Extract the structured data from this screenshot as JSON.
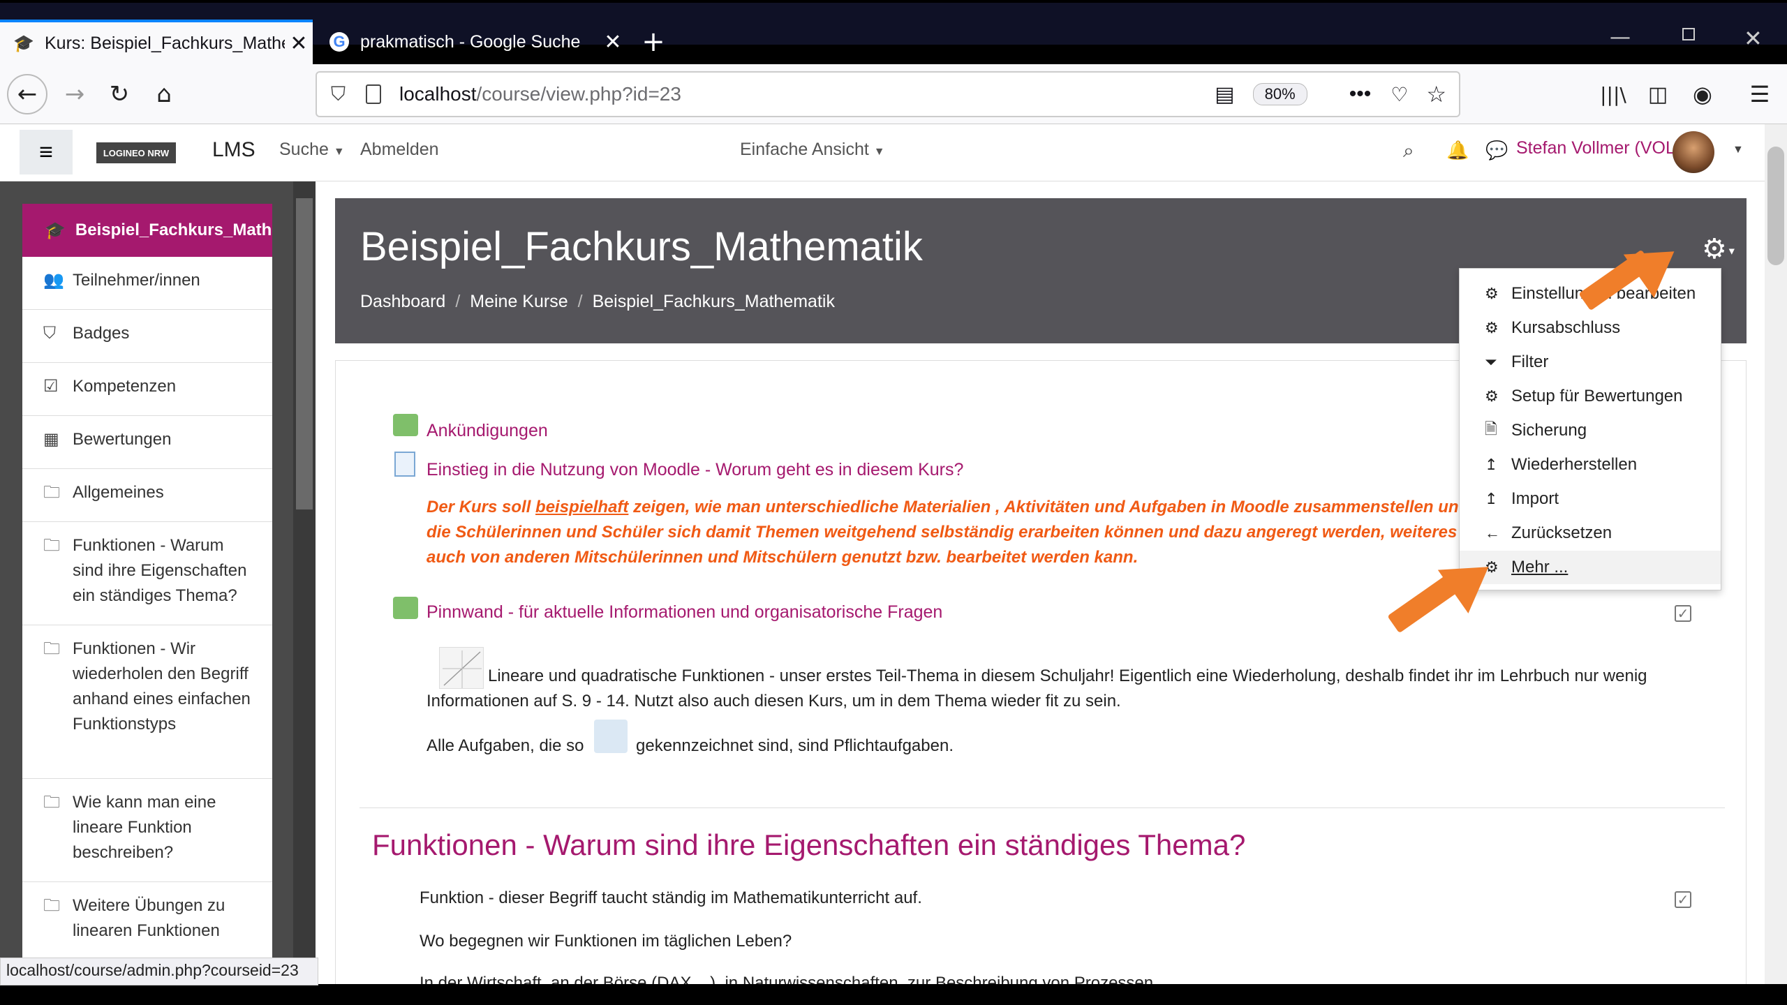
{
  "browser": {
    "tabs": [
      {
        "title": "Kurs: Beispiel_Fachkurs_Mathem"
      },
      {
        "title": "prakmatisch - Google Suche"
      }
    ],
    "url_host": "localhost",
    "url_path": "/course/view.php?id=23",
    "zoom": "80%",
    "status_url": "localhost/course/admin.php?courseid=23"
  },
  "header": {
    "logo_text": "LOGINEO NRW",
    "app": "LMS",
    "search": "Suche",
    "logout": "Abmelden",
    "view": "Einfache Ansicht",
    "user": "Stefan Vollmer (VOL)"
  },
  "sidebar": {
    "course": "Beispiel_Fachkurs_Mathematik",
    "items": [
      {
        "icon": "users-icon",
        "label": "Teilnehmer/innen"
      },
      {
        "icon": "shield-icon",
        "label": "Badges"
      },
      {
        "icon": "check-square-icon",
        "label": "Kompetenzen"
      },
      {
        "icon": "table-icon",
        "label": "Bewertungen"
      },
      {
        "icon": "folder-icon",
        "label": "Allgemeines"
      },
      {
        "icon": "folder-icon",
        "label": "Funktionen - Warum sind ihre Eigenschaften ein ständiges Thema?"
      },
      {
        "icon": "folder-icon",
        "label": "Funktionen - Wir wiederholen den Begriff anhand eines einfachen Funktionstyps"
      },
      {
        "icon": "folder-icon",
        "label": "Wie kann man eine lineare Funktion beschreiben?"
      },
      {
        "icon": "folder-icon",
        "label": "Weitere Übungen zu linearen Funktionen"
      }
    ]
  },
  "course": {
    "title": "Beispiel_Fachkurs_Mathematik",
    "breadcrumb": [
      "Dashboard",
      "Meine Kurse",
      "Beispiel_Fachkurs_Mathematik"
    ],
    "announcements": "Ankündigungen",
    "intro_link": "Einstieg in die Nutzung von Moodle - Worum geht es in diesem Kurs?",
    "orange_1a": "Der Kurs soll ",
    "orange_1b": "beispielhaft",
    "orange_1c": " zeigen, wie man unterschiedliche Materialien , Aktivitäten und Aufgaben in Moodle zusammenstellen und",
    "orange_2": "die Schülerinnen und Schüler sich damit Themen weitgehend selbständig erarbeiten können und dazu angeregt werden, weiteres M",
    "orange_3": "auch von anderen Mitschülerinnen und Mitschülern genutzt bzw. bearbeitet werden kann.",
    "pinnwand": "Pinnwand - für aktuelle Informationen und organisatorische Fragen",
    "lin_1": "Lineare und quadratische Funktionen - unser erstes Teil-Thema in diesem Schuljahr! Eigentlich eine Wiederholung, deshalb findet ihr im Lehrbuch nur wenig",
    "lin_2": "Informationen auf S. 9 - 14. Nutzt also auch diesen Kurs, um in dem Thema wieder fit zu sein.",
    "tasks_a": "Alle Aufgaben, die so",
    "tasks_b": "gekennzeichnet sind, sind Pflichtaufgaben.",
    "section_title": "Funktionen - Warum sind ihre Eigenschaften ein ständiges Thema?",
    "sec_1": "Funktion - dieser Begriff taucht ständig im Mathematikunterricht auf.",
    "sec_2": "Wo begegnen wir Funktionen im täglichen Leben?",
    "sec_3": "In der Wirtschaft, an der Börse (DAX ...), in Naturwissenschaften, zur Beschreibung von Prozessen..."
  },
  "menu": {
    "items": [
      {
        "icon": "gear-icon",
        "label": "Einstellungen bearbeiten"
      },
      {
        "icon": "gear-icon",
        "label": "Kursabschluss"
      },
      {
        "icon": "filter-icon",
        "label": "Filter"
      },
      {
        "icon": "gear-icon",
        "label": "Setup für Bewertungen"
      },
      {
        "icon": "file-icon",
        "label": "Sicherung"
      },
      {
        "icon": "upload-icon",
        "label": "Wiederherstellen"
      },
      {
        "icon": "upload-icon",
        "label": "Import"
      },
      {
        "icon": "arrow-left-icon",
        "label": "Zurücksetzen"
      },
      {
        "icon": "gear-icon",
        "label": "Mehr ..."
      }
    ]
  },
  "colors": {
    "accent": "#a5196e",
    "banner": "#555459",
    "orange": "#f05a14",
    "arrow": "#f07e2a"
  }
}
